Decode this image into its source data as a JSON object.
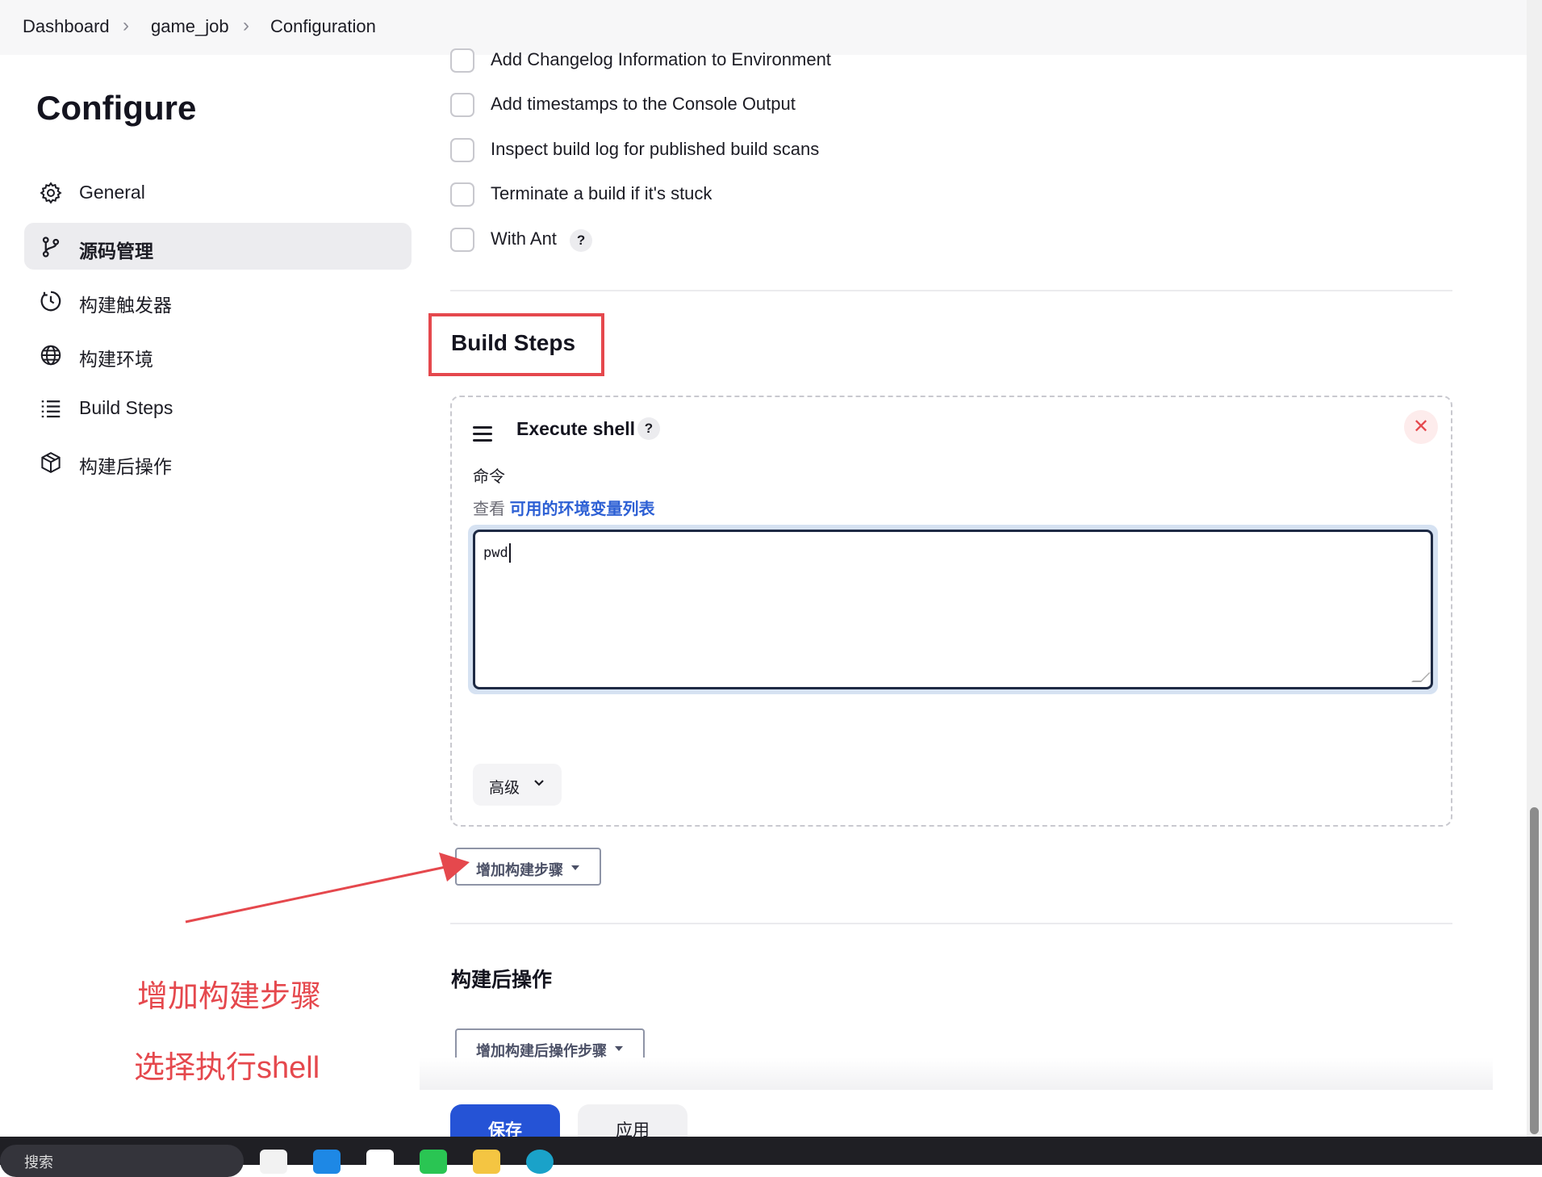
{
  "breadcrumb": {
    "items": [
      "Dashboard",
      "game_job",
      "Configuration"
    ]
  },
  "sidebar": {
    "title": "Configure",
    "items": [
      {
        "label": "General",
        "icon": "gear-icon"
      },
      {
        "label": "源码管理",
        "icon": "branch-icon",
        "active": true
      },
      {
        "label": "构建触发器",
        "icon": "clock-icon"
      },
      {
        "label": "构建环境",
        "icon": "globe-icon"
      },
      {
        "label": "Build Steps",
        "icon": "list-icon"
      },
      {
        "label": "构建后操作",
        "icon": "package-icon"
      }
    ]
  },
  "environment_options": [
    {
      "label": "Add Changelog Information to Environment",
      "checked": false
    },
    {
      "label": "Add timestamps to the Console Output",
      "checked": false
    },
    {
      "label": "Inspect build log for published build scans",
      "checked": false
    },
    {
      "label": "Terminate a build if it's stuck",
      "checked": false
    },
    {
      "label": "With Ant",
      "checked": false,
      "help": "?"
    }
  ],
  "build_steps": {
    "title": "Build Steps",
    "step": {
      "title": "Execute shell",
      "help": "?",
      "close": "✕",
      "command_label": "命令",
      "env_prefix": "查看",
      "env_link": "可用的环境变量列表",
      "command_value": "pwd",
      "advanced_label": "高级"
    },
    "add_step_label": "增加构建步骤"
  },
  "post_build": {
    "title": "构建后操作",
    "add_label": "增加构建后操作步骤"
  },
  "annotations": {
    "note1": "增加构建步骤",
    "note2": "选择执行shell"
  },
  "actions": {
    "save_label": "保存",
    "apply_label": "应用"
  },
  "taskbar": {
    "search_label": "搜索"
  },
  "colors": {
    "accent": "#2553d6",
    "annotation_red": "#e5484d",
    "link": "#2c5fd4"
  }
}
